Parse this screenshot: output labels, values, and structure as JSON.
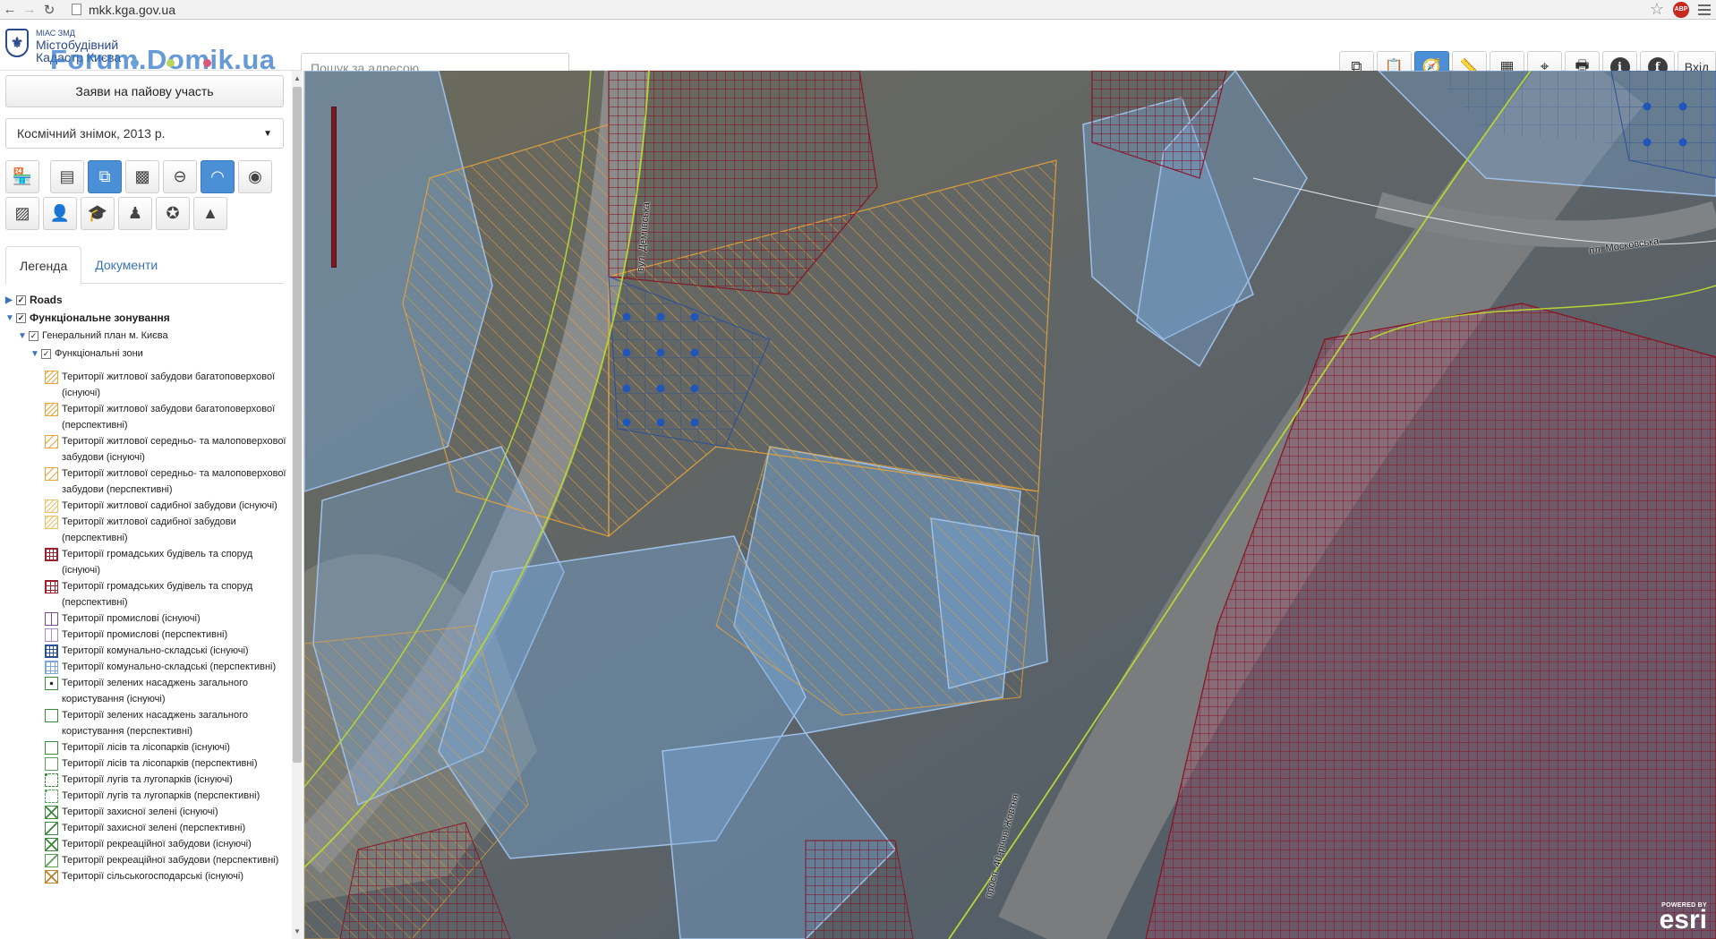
{
  "browser": {
    "url": "mkk.kga.gov.ua",
    "back_glyph": "←",
    "forward_glyph": "→",
    "reload_glyph": "↻",
    "star_glyph": "☆",
    "adblock_label": "ABP"
  },
  "header": {
    "logo_small": "МІАС ЗМД",
    "logo_title_line1": "Містобудівний",
    "logo_title_line2": "Кадастр Києва",
    "watermark": "Forum.Domik.ua",
    "dot_colors": [
      "#6aa3d8",
      "#b8d65b",
      "#d65b7a"
    ],
    "search_placeholder": "Пошук за адресою...",
    "toolbar": [
      {
        "name": "layers-icon",
        "glyph": "⧉",
        "active": false
      },
      {
        "name": "clipboard-icon",
        "glyph": "📋",
        "active": false
      },
      {
        "name": "compass-icon",
        "glyph": "🧭",
        "active": true
      },
      {
        "name": "ruler-icon",
        "glyph": "📏",
        "active": false
      },
      {
        "name": "measure-area-icon",
        "glyph": "▦",
        "active": false
      },
      {
        "name": "crosshair-icon",
        "glyph": "⌖",
        "active": false
      },
      {
        "name": "print-icon",
        "glyph": "🖶",
        "active": false
      }
    ],
    "info_glyph": "i",
    "facebook_glyph": "f",
    "login_label": "Вхід"
  },
  "sidebar": {
    "share_button": "Заяви на пайову участь",
    "basemap_select": "Космічний знімок, 2013 р.",
    "layer_buttons_row1": [
      {
        "name": "shop-icon",
        "glyph": "🏪",
        "active": false
      },
      {
        "name": "document-plan-icon",
        "glyph": "▤",
        "active": false
      },
      {
        "name": "zoning-icon",
        "glyph": "⧉",
        "active": true
      },
      {
        "name": "texture-icon",
        "glyph": "▩",
        "active": false
      },
      {
        "name": "no-entry-icon",
        "glyph": "⊖",
        "active": false
      },
      {
        "name": "relief-icon",
        "glyph": "◠",
        "active": true
      },
      {
        "name": "orbit-icon",
        "glyph": "◉",
        "active": false
      }
    ],
    "layer_buttons_row2": [
      {
        "name": "map-tile-icon",
        "glyph": "▨",
        "active": false
      },
      {
        "name": "person-icon",
        "glyph": "👤",
        "active": false
      },
      {
        "name": "graduation-cap-icon",
        "glyph": "🎓",
        "active": false
      },
      {
        "name": "monument-icon",
        "glyph": "♟",
        "active": false
      },
      {
        "name": "police-badge-icon",
        "glyph": "✪",
        "active": false
      },
      {
        "name": "road-sign-icon",
        "glyph": "▲",
        "active": false
      }
    ],
    "tabs": [
      "Легенда",
      "Документи"
    ],
    "tree": {
      "roads": "Roads",
      "func_zoning": "Функціональне зонування",
      "general_plan": "Генеральний план м. Києва",
      "func_zones": "Функціональні зони"
    },
    "legend": [
      {
        "label": "Території житлової забудови багатоповерхової (існуючі)",
        "color": "#e8a43a",
        "pattern": "hatch"
      },
      {
        "label": "Території житлової забудови багатоповерхової (перспективні)",
        "color": "#e8a43a",
        "pattern": "hatch"
      },
      {
        "label": "Території житлової середньо- та малоповерхової забудови (існуючі)",
        "color": "#e8a43a",
        "pattern": "hatch-light"
      },
      {
        "label": "Території житлової середньо- та малоповерхової забудови (перспективні)",
        "color": "#e8a43a",
        "pattern": "hatch-light"
      },
      {
        "label": "Території житлової садибної забудови (існуючі)",
        "color": "#f0c060",
        "pattern": "hatch"
      },
      {
        "label": "Території житлової садибної забудови (перспективні)",
        "color": "#f0c060",
        "pattern": "hatch"
      },
      {
        "label": "Території громадських будівель та споруд (існуючі)",
        "color": "#9a1f2a",
        "pattern": "grid"
      },
      {
        "label": "Території громадських будівель та споруд (перспективні)",
        "color": "#9a1f2a",
        "pattern": "grid-light"
      },
      {
        "label": "Території промислові (існуючі)",
        "color": "#7a4a8a",
        "pattern": "vlines"
      },
      {
        "label": "Території промислові (перспективні)",
        "color": "#b08ac0",
        "pattern": "vlines"
      },
      {
        "label": "Території комунально-складські (існуючі)",
        "color": "#2a4f9a",
        "pattern": "grid"
      },
      {
        "label": "Території комунально-складські (перспективні)",
        "color": "#7fa6d8",
        "pattern": "grid-light"
      },
      {
        "label": "Території зелених насаджень загального користування (існуючі)",
        "color": "#3a8a3a",
        "pattern": "dot"
      },
      {
        "label": "Території зелених насаджень загального користування (перспективні)",
        "color": "#3a8a3a",
        "pattern": "empty"
      },
      {
        "label": "Території лісів та лісопарків (існуючі)",
        "color": "#3a8a3a",
        "pattern": "empty"
      },
      {
        "label": "Території лісів та лісопарків (перспективні)",
        "color": "#5aa05a",
        "pattern": "empty"
      },
      {
        "label": "Території лугів та лугопарків (існуючі)",
        "color": "#3a8a3a",
        "pattern": "corner"
      },
      {
        "label": "Території лугів та лугопарків (перспективні)",
        "color": "#5aa05a",
        "pattern": "corner"
      },
      {
        "label": "Території захисної зелені (існуючі)",
        "color": "#3a8a3a",
        "pattern": "cross"
      },
      {
        "label": "Території захисної зелені (перспективні)",
        "color": "#3a8a3a",
        "pattern": "diag"
      },
      {
        "label": "Території рекреаційної забудови (існуючі)",
        "color": "#3a8a3a",
        "pattern": "cross"
      },
      {
        "label": "Території рекреаційної забудови (перспективні)",
        "color": "#5aa05a",
        "pattern": "diag"
      },
      {
        "label": "Території сільськогосподарські (існуючі)",
        "color": "#c0802a",
        "pattern": "cross"
      }
    ]
  },
  "map": {
    "street_labels": [
      {
        "text": "вул. Деміївська",
        "rotate": -85
      },
      {
        "text": "пл. Московська",
        "rotate": -8
      },
      {
        "text": "просп. 40-річчя Жовтня",
        "rotate": -75
      }
    ],
    "esri_small": "POWERED BY",
    "esri_big": "esri"
  }
}
